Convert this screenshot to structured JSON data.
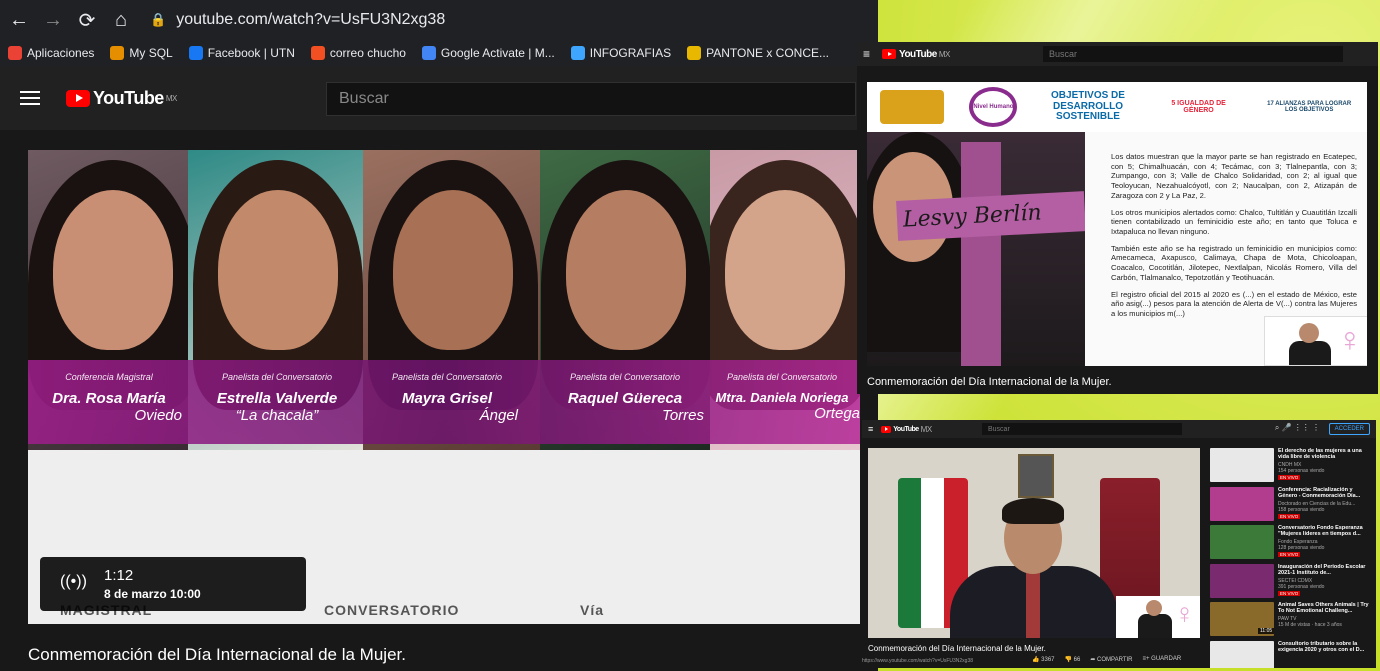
{
  "main_window": {
    "url": "youtube.com/watch?v=UsFU3N2xg38",
    "bookmarks": [
      {
        "label": "Aplicaciones",
        "icon": "apps-grid-icon",
        "color": "#ea4335"
      },
      {
        "label": "My SQL",
        "icon": "mysql-icon",
        "color": "#e48e00"
      },
      {
        "label": "Facebook | UTN",
        "icon": "facebook-icon",
        "color": "#1877f2"
      },
      {
        "label": "correo chucho",
        "icon": "microsoft-icon",
        "color": "#f25022"
      },
      {
        "label": "Google Activate | M...",
        "icon": "google-icon",
        "color": "#4285f4"
      },
      {
        "label": "INFOGRAFIAS",
        "icon": "circle-icon",
        "color": "#3ea6ff"
      },
      {
        "label": "PANTONE x CONCE...",
        "icon": "pantone-icon",
        "color": "#e8b800"
      }
    ],
    "logo_region": "MX",
    "logo_text": "YouTube",
    "search_placeholder": "Buscar",
    "video": {
      "panels": [
        {
          "role": "Conferencia Magistral",
          "name": "Dra. Rosa María",
          "surname": "Oviedo"
        },
        {
          "role": "Panelista del Conversatorio",
          "name": "Estrella Valverde",
          "surname": "“La chacala”"
        },
        {
          "role": "Panelista del Conversatorio",
          "name": "Mayra Grisel",
          "surname": "Ángel"
        },
        {
          "role": "Panelista del Conversatorio",
          "name": "Raquel Güereca",
          "surname": "Torres"
        },
        {
          "role": "Panelista del Conversatorio",
          "name": "Mtra. Daniela Noriega",
          "surname": "Ortega"
        }
      ],
      "lower_words": [
        "MAGISTRAL",
        "CONVERSATORIO",
        "Vía"
      ],
      "live_time": "1:12",
      "live_date": "8 de marzo 10:00"
    },
    "title": "Conmemoración del Día Internacional de la Mujer."
  },
  "top_right_window": {
    "logo_text": "YouTube",
    "logo_region": "MX",
    "search_placeholder": "Buscar",
    "logos": [
      "Nivel Humano",
      "OBJETIVOS DE DESARROLLO SOSTENIBLE",
      "5 IGUALDAD DE GÉNERO",
      "17 ALIANZAS PARA LOGRAR LOS OBJETIVOS"
    ],
    "cross_text": "Lesvy Berlín",
    "paragraphs": [
      "Los datos muestran que la mayor parte se han registrado en Ecatepec, con 5; Chimalhuacán, con 4; Tecámac, con 3; Tlalnepantla, con 3; Zumpango, con 3; Valle de Chalco Solidaridad, con 2; al igual que Teoloyucan, Nezahualcóyotl, con 2; Naucalpan, con 2, Atizapán de Zaragoza con 2 y La Paz, 2.",
      "Los otros municipios alertados como: Chalco, Tultitlán y Cuautitlán Izcalli tienen contabilizado un feminicidio este año; en tanto que Toluca e Ixtapaluca no llevan ninguno.",
      "También este año se ha registrado un feminicidio en municipios como: Amecameca, Axapusco, Calimaya, Chapa de Mota, Chicoloapan, Coacalco, Cocotitlán, Jilotepec, Nextlalpan, Nicolás Romero, Villa del Carbón, Tlalmanalco, Tepotzotlán y Teotihuacán.",
      "El registro oficial del 2015 al 2020 es (...) en el estado de México, este año asig(...) pesos para la atención de Alerta de V(...) contra las Mujeres a los municipios m(...)"
    ],
    "title": "Conmemoración del Día Internacional de la Mujer."
  },
  "bottom_right_window": {
    "logo_text": "YouTube",
    "logo_region": "MX",
    "search_placeholder": "Buscar",
    "account_label": "ACCEDER",
    "title": "Conmemoración del Día Internacional de la Mujer.",
    "url": "https://www.youtube.com/watch?v=UsFU3N2xg38",
    "likes": "3367",
    "dislikes": "66",
    "share_label": "COMPARTIR",
    "save_label": "GUARDAR",
    "recommendations": [
      {
        "title": "El derecho de las mujeres a una vida libre de violencia",
        "channel": "CNDH MX",
        "meta": "154 personas viendo",
        "badge": "EN VIVO",
        "color": "#e8e8e8",
        "duration": ""
      },
      {
        "title": "Conferencia: Racialización y Género - Conmemoración Día...",
        "channel": "Doctorado en Ciencias de la Edu...",
        "meta": "158 personas viendo",
        "badge": "EN VIVO",
        "color": "#b23d8f",
        "duration": ""
      },
      {
        "title": "Conversatorio Fondo Esperanza \"Mujeres líderes en tiempos d...",
        "channel": "Fondo Esperanza",
        "meta": "128 personas viendo",
        "badge": "EN VIVO",
        "color": "#3c7a3a",
        "duration": ""
      },
      {
        "title": "Inauguración del Periodo Escolar 2021-1 Instituto de...",
        "channel": "SECTEI CDMX",
        "meta": "391 personas viendo",
        "badge": "EN VIVO",
        "color": "#7a2a6e",
        "duration": ""
      },
      {
        "title": "Animal Saves Others Animals | Try To Not Emotional Challeng...",
        "channel": "PAW TV",
        "meta": "15 M de vistas · hace 3 años",
        "badge": "",
        "color": "#8a6a2a",
        "duration": "11:05"
      },
      {
        "title": "Consultorio tributario sobre la exigencia 2020 y otros con el D...",
        "channel": "",
        "meta": "",
        "badge": "",
        "color": "#e8e8e8",
        "duration": ""
      }
    ]
  }
}
